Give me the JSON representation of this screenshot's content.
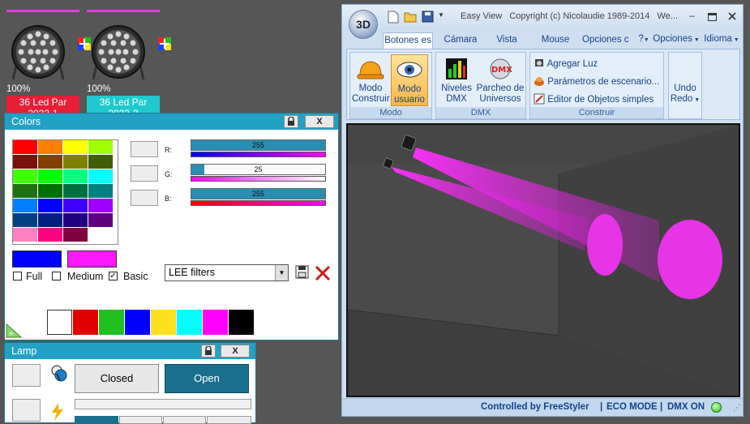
{
  "fixtures": [
    {
      "percent": "100%",
      "name_line1": "36 Led Par",
      "name_line2": "2023-1",
      "color": "#e81e35"
    },
    {
      "percent": "100%",
      "name_line1": "36 Led Par",
      "name_line2": "2023-2",
      "color": "#1ecacd"
    }
  ],
  "colors_panel": {
    "title": "Colors",
    "lock_icon": "lock-icon",
    "close_label": "X",
    "grid": [
      [
        "#ff0000",
        "#ff8000",
        "#ffff00",
        "#a0ff00"
      ],
      [
        "#7a1010",
        "#804000",
        "#808000",
        "#406000"
      ],
      [
        "#40ff00",
        "#00ff00",
        "#00ff80",
        "#00ffff"
      ],
      [
        "#207010",
        "#007000",
        "#007040",
        "#008080"
      ],
      [
        "#0080ff",
        "#0000ff",
        "#4000ff",
        "#a000ff"
      ],
      [
        "#004080",
        "#002080",
        "#200080",
        "#600080"
      ],
      [
        "#ff80c0",
        "#ff0080",
        "#800040",
        "#ffffff"
      ]
    ],
    "r_label": "R:",
    "g_label": "G:",
    "b_label": "B:",
    "r_value": "255",
    "g_value": "25",
    "b_value": "255",
    "r_level": 255,
    "g_level": 25,
    "b_level": 255,
    "r_gradient": [
      "#0000ff",
      "#ff00ff"
    ],
    "g_gradient": [
      "#ff00ff",
      "#ffffff"
    ],
    "b_gradient": [
      "#ff0000",
      "#ff00ff"
    ],
    "full_color": "#0000ff",
    "basic_color": "#ff19ff",
    "opt_full": "Full",
    "opt_medium": "Medium",
    "opt_basic": "Basic",
    "opt_basic_checked": "✓",
    "filter_value": "LEE filters",
    "dropdown_arrow": "▼",
    "basic_swatches": [
      "#ffffff",
      "#e00000",
      "#20c020",
      "#0000ff",
      "#ffe020",
      "#00ffff",
      "#ff00ff",
      "#000000"
    ]
  },
  "lamp_panel": {
    "title": "Lamp",
    "close_label": "X",
    "closed_label": "Closed",
    "open_label": "Open"
  },
  "window": {
    "title": "Easy View   Copyright (c) Nicolaudie 1989-2014   We...",
    "logo": "3D",
    "tabs": [
      "Botones es",
      "Cámara",
      "Vista",
      "Mouse",
      "Opciones c"
    ],
    "right_tabs": {
      "help": "?",
      "options": "Opciones",
      "language": "Idioma"
    },
    "modo": {
      "construir": [
        "Modo",
        "Construir"
      ],
      "usuario": [
        "Modo",
        "usuario"
      ],
      "label": "Modo"
    },
    "dmx": {
      "niveles": [
        "Niveles",
        "DMX"
      ],
      "parcheo": [
        "Parcheo de",
        "Universos"
      ],
      "label": "DMX"
    },
    "construir": {
      "agregar": "Agregar Luz",
      "parametros": "Parámetros de escenario...",
      "editor": "Editor de Objetos simples",
      "label": "Construir"
    },
    "undo": {
      "line1": "Undo",
      "line2": "Redo"
    },
    "status": {
      "controlled": "Controlled by FreeStyler",
      "eco": "ECO MODE",
      "dmx": "DMX ON"
    }
  }
}
